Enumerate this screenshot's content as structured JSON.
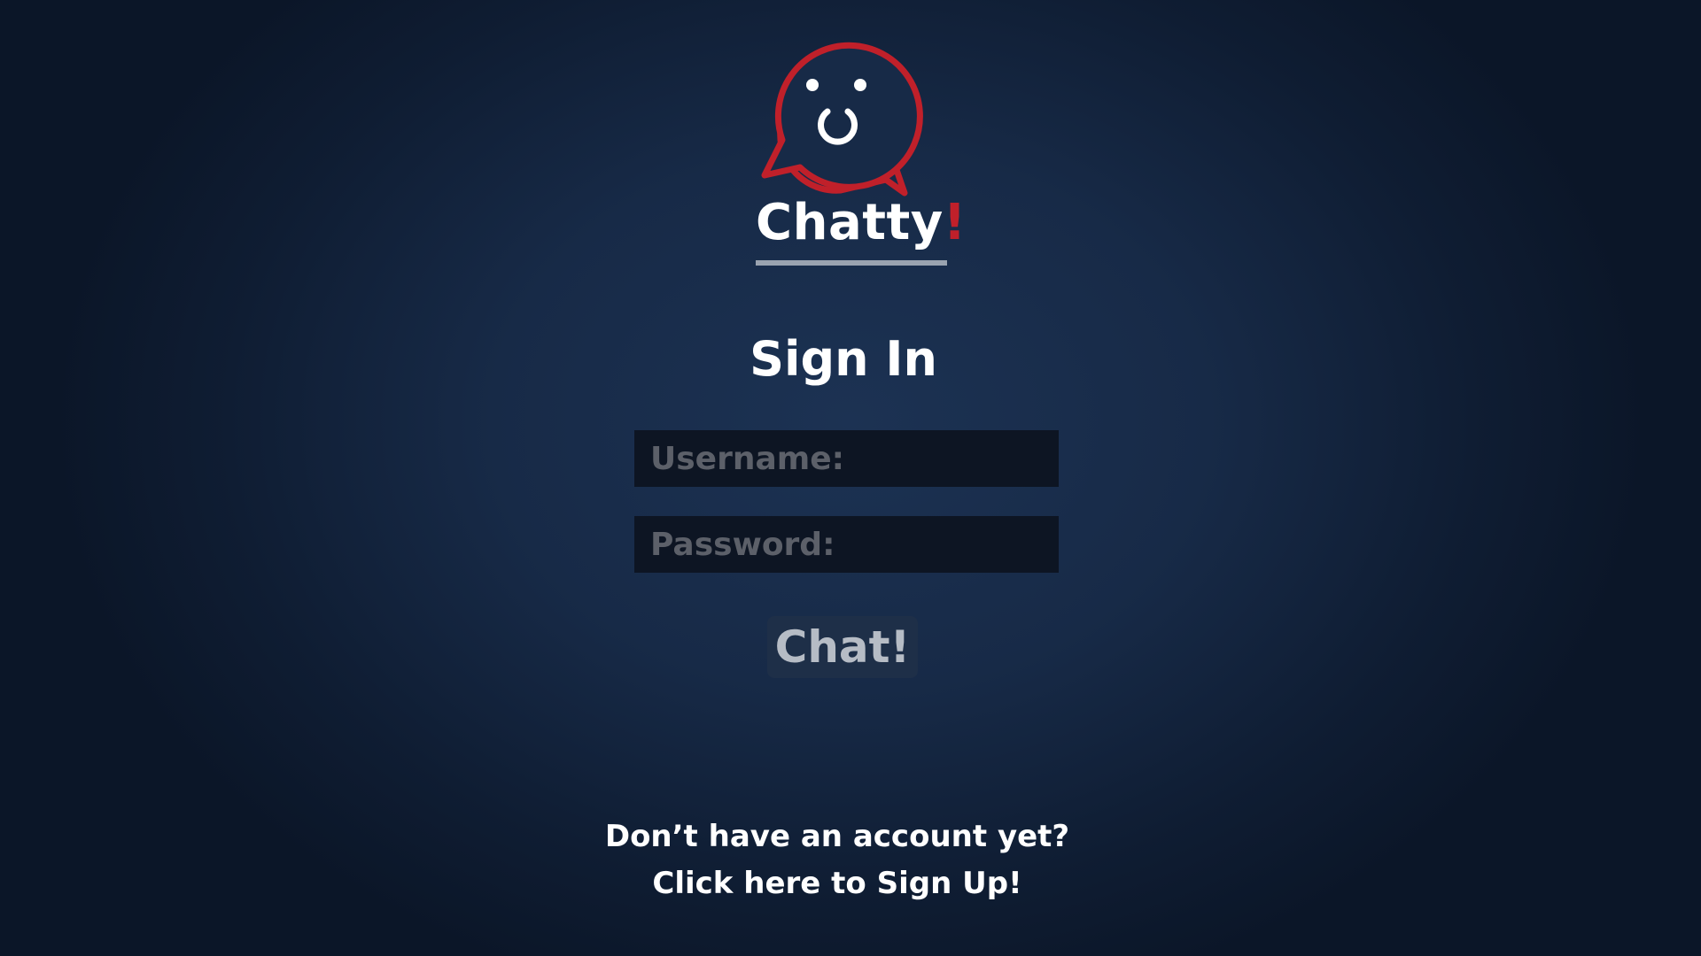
{
  "brand": {
    "name": "Chatty",
    "exclamation": "!",
    "accent_color": "#c0202a",
    "logo_icon": "chat-bubbles-smiley-icon"
  },
  "form": {
    "title": "Sign In",
    "username_placeholder": "Username:",
    "password_placeholder": "Password:",
    "submit_label": "Chat!"
  },
  "footer": {
    "question": "Don’t have an account yet?",
    "signup_link": "Click here to Sign Up!"
  },
  "colors": {
    "background": "#172a47",
    "input_background": "#0d1523",
    "placeholder": "#5c6069",
    "button_text": "#b6bcc5"
  }
}
